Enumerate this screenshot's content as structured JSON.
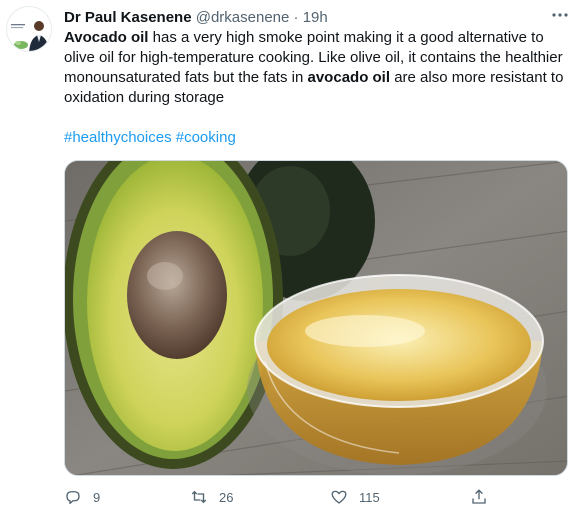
{
  "tweet": {
    "author_name": "Dr Paul Kasenene",
    "author_handle": "@drkasenene",
    "separator": "·",
    "time": "19h",
    "text_parts": [
      "Avocado oil",
      " has a very high smoke point making it a good alternative to olive oil for high-temperature cooking. Like olive oil, it contains the healthier monounsaturated fats but the fats in ",
      "avocado oil",
      " are also more resistant to oxidation during storage"
    ],
    "hashtags": [
      "#healthychoices",
      "#cooking"
    ],
    "media_description": "avocado-half-and-bowl-of-oil"
  },
  "actions": {
    "replies": "9",
    "retweets": "26",
    "likes": "115"
  },
  "colors": {
    "link": "#1d9bf0",
    "secondary_text": "#536471",
    "primary_text": "#0f1419"
  },
  "icons": {
    "reply": "reply-icon",
    "retweet": "retweet-icon",
    "like": "heart-icon",
    "share": "share-icon",
    "more": "more-icon"
  }
}
